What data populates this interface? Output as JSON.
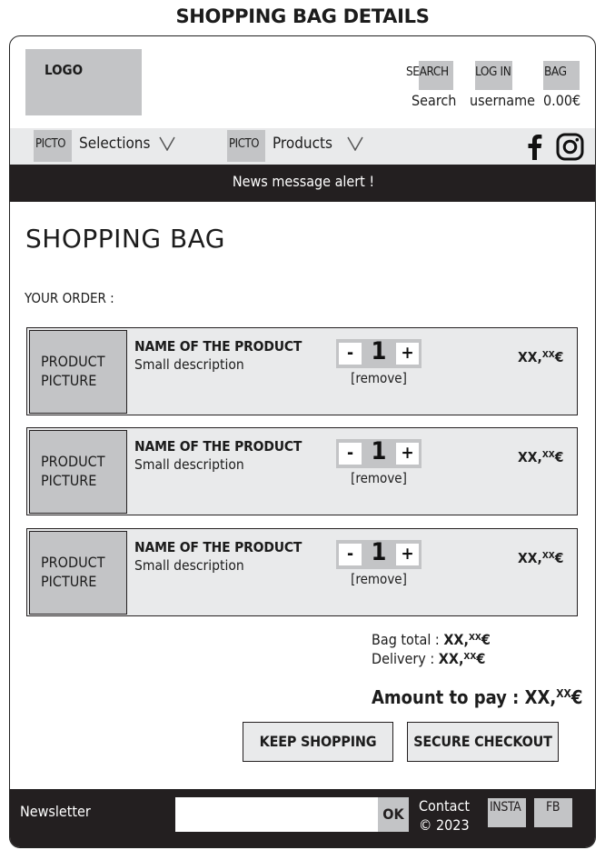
{
  "page_title": "SHOPPING BAG DETAILS",
  "header": {
    "logo": "LOGO",
    "search_box": "SEARCH",
    "search_text": "Search",
    "login_box": "LOG IN",
    "login_text": "username",
    "bag_box": "BAG",
    "bag_text": "0.00€"
  },
  "nav": {
    "items": [
      {
        "picto": "PICTO",
        "label": "Selections",
        "icon": "chevron-down-icon"
      },
      {
        "picto": "PICTO",
        "label": "Products",
        "icon": "chevron-down-icon"
      }
    ],
    "social_icons": [
      "facebook-icon",
      "instagram-icon"
    ]
  },
  "alert": "News message alert !",
  "main": {
    "title": "SHOPPING BAG",
    "order_label": "YOUR ORDER :",
    "products": [
      {
        "picture": "PRODUCT PICTURE",
        "name": "NAME OF THE PRODUCT",
        "description": "Small description",
        "minus": "-",
        "quantity": "1",
        "plus": "+",
        "remove": "[remove]",
        "price_main": "XX,",
        "price_cents": "XX",
        "price_currency": "€"
      },
      {
        "picture": "PRODUCT PICTURE",
        "name": "NAME OF THE PRODUCT",
        "description": "Small description",
        "minus": "-",
        "quantity": "1",
        "plus": "+",
        "remove": "[remove]",
        "price_main": "XX,",
        "price_cents": "XX",
        "price_currency": "€"
      },
      {
        "picture": "PRODUCT PICTURE",
        "name": "NAME OF THE PRODUCT",
        "description": "Small description",
        "minus": "-",
        "quantity": "1",
        "plus": "+",
        "remove": "[remove]",
        "price_main": "XX,",
        "price_cents": "XX",
        "price_currency": "€"
      }
    ],
    "bag_total_label": "Bag total :",
    "bag_total_main": "XX,",
    "bag_total_cents": "XX",
    "bag_total_currency": "€",
    "delivery_label": "Delivery :",
    "delivery_main": "XX,",
    "delivery_cents": "XX",
    "delivery_currency": "€",
    "amount_label": "Amount to pay :",
    "amount_main": "XX,",
    "amount_cents": "XX",
    "amount_currency": "€",
    "keep_shopping": "KEEP SHOPPING",
    "secure_checkout": "SECURE CHECKOUT"
  },
  "footer": {
    "newsletter": "Newsletter",
    "newsletter_value": "",
    "ok": "OK",
    "contact": "Contact",
    "copyright": "© 2023",
    "insta": "INSTA",
    "fb": "FB"
  },
  "colors": {
    "placeholder_gray": "#c3c4c6",
    "light_gray": "#e9eaeb",
    "dark": "#231f20"
  }
}
